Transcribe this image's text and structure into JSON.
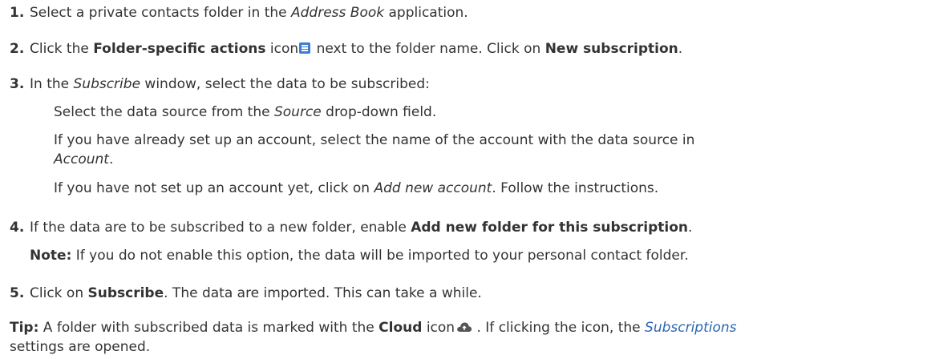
{
  "steps": [
    {
      "num": "1.",
      "parts": [
        "Select a private contacts folder in the ",
        "Address Book",
        " application."
      ]
    },
    {
      "num": "2.",
      "parts": [
        "Click the ",
        "Folder-specific actions",
        " icon",
        " next to the folder name. Click on ",
        "New subscription",
        "."
      ]
    },
    {
      "num": "3.",
      "parts": [
        "In the ",
        "Subscribe",
        " window, select the data to be subscribed:"
      ]
    },
    {
      "num": "4.",
      "parts": [
        "If the data are to be subscribed to a new folder, enable ",
        "Add new folder for this subscription",
        "."
      ]
    },
    {
      "num": "5.",
      "parts": [
        "Click on ",
        "Subscribe",
        ". The data are imported. This can take a while."
      ]
    }
  ],
  "substeps": [
    {
      "parts": [
        "Select the data source from the ",
        "Source",
        " drop-down field."
      ]
    },
    {
      "parts": [
        "If you have already set up an account, select the name of the account with the data source in"
      ]
    },
    {
      "parts": [
        "Account",
        "."
      ]
    },
    {
      "parts": [
        "If you have not set up an account yet, click on ",
        "Add new account",
        ". Follow the instructions."
      ]
    }
  ],
  "note": {
    "label": "Note:",
    "text": " If you do not enable this option, the data will be imported to your personal contact folder."
  },
  "tip": {
    "label": "Tip:",
    "line1": [
      " A folder with subscribed data is marked with the ",
      "Cloud",
      " icon",
      " . If clicking the icon, the ",
      "Subscriptions"
    ],
    "line2": "settings are opened."
  },
  "icons": {
    "menu": "folder-actions-menu-icon",
    "cloud": "cloud-icon"
  },
  "colors": {
    "text": "#333333",
    "accent": "#3a7ed6",
    "link": "#2a66b3"
  }
}
